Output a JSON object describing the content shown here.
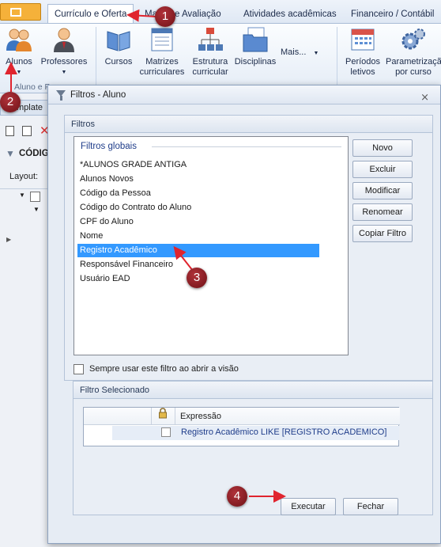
{
  "ribbon": {
    "tabs": [
      "Currículo e Oferta",
      "Matrizes e Avaliação",
      "Atividades acadêmicas",
      "Financeiro / Contábil"
    ],
    "active_tab": "Currículo e Oferta",
    "tab_visible_text": [
      "Currículo e Oferta",
      "Ma",
      "e Avaliação",
      "Atividades acadêmicas",
      "Financeiro / Contábil"
    ],
    "buttons": {
      "alunos": "Alunos",
      "professores": "Professores",
      "cursos": "Cursos",
      "matrizes_line1": "Matrizes",
      "matrizes_line2": "curriculares",
      "estrutura_line1": "Estrutura",
      "estrutura_line2": "curricular",
      "disciplinas": "Disciplinas",
      "mais": "Mais...",
      "periodos_line1": "Períodos",
      "periodos_line2": "letivos",
      "param_line1": "Parametrizaçã",
      "param_line2": "por curso"
    },
    "group_label": "Aluno e P"
  },
  "background": {
    "tab": "mplate",
    "search_label": "CÓDIG",
    "layout_label": "Layout:"
  },
  "dialog": {
    "title": "Filtros - Aluno",
    "filters_panel_title": "Filtros",
    "list_group": "Filtros globais",
    "items": [
      "*ALUNOS GRADE ANTIGA",
      "Alunos Novos",
      "Código da Pessoa",
      "Código do Contrato do Aluno",
      "CPF do Aluno",
      "Nome",
      "Registro Acadêmico",
      "Responsável Financeiro",
      "Usuário EAD"
    ],
    "selected_item": "Registro Acadêmico",
    "buttons": {
      "novo": "Novo",
      "excluir": "Excluir",
      "modificar": "Modificar",
      "renomear": "Renomear",
      "copiar": "Copiar Filtro"
    },
    "always_use_label": "Sempre usar este filtro ao abrir a visão",
    "always_use_checked": false,
    "selected_panel_title": "Filtro Selecionado",
    "grid": {
      "column_header": "Expressão",
      "rows": [
        {
          "checked": false,
          "expression": "Registro Acadêmico LIKE [REGISTRO ACADEMICO]"
        }
      ]
    },
    "footer": {
      "executar": "Executar",
      "fechar": "Fechar"
    }
  },
  "callouts": [
    "1",
    "2",
    "3",
    "4"
  ],
  "colors": {
    "accent": "#3399ff",
    "callout": "#8b1c22",
    "arrow": "#e0242e",
    "link": "#1f3d8a"
  }
}
